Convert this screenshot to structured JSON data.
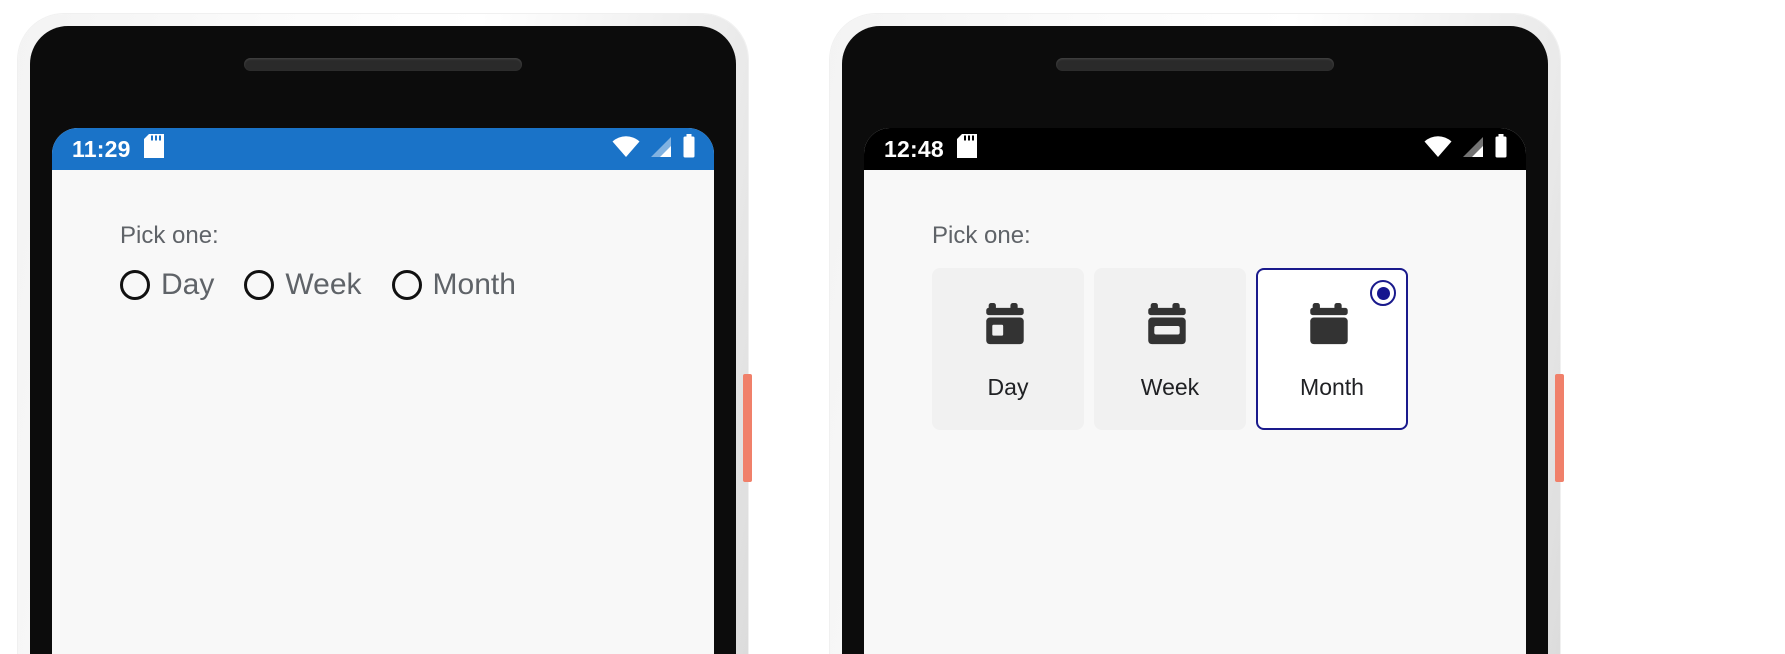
{
  "background_color": "#ffffff",
  "phones": [
    {
      "id": "left",
      "variant": "plain-radio-buttons",
      "status_bar": {
        "background_color": "#1a73c8",
        "time": "11:29",
        "left_icons": [
          "sd-card-icon"
        ],
        "right_icons": [
          "wifi-icon",
          "cellular-signal-icon",
          "battery-icon"
        ]
      },
      "screen": {
        "background_color": "#f8f8f8",
        "prompt": "Pick one:",
        "control_type": "radio-group",
        "options": [
          {
            "label": "Day",
            "selected": false
          },
          {
            "label": "Week",
            "selected": false
          },
          {
            "label": "Month",
            "selected": false
          }
        ]
      },
      "hardware": {
        "power_button_color": "#f0806a",
        "bezel_color": "#f1f1f1",
        "screen_color": "#0c0c0c"
      }
    },
    {
      "id": "right",
      "variant": "card-selection-group",
      "status_bar": {
        "background_color": "#000000",
        "time": "12:48",
        "left_icons": [
          "sd-card-icon"
        ],
        "right_icons": [
          "wifi-icon",
          "cellular-signal-icon",
          "battery-icon"
        ]
      },
      "screen": {
        "background_color": "#f8f8f8",
        "prompt": "Pick one:",
        "control_type": "selectable-cards",
        "selected_color": "#1a1a8c",
        "card_background": "#f1f1f1",
        "card_selected_background": "#ffffff",
        "options": [
          {
            "label": "Day",
            "icon": "calendar-day-icon",
            "selected": false
          },
          {
            "label": "Week",
            "icon": "calendar-week-icon",
            "selected": false
          },
          {
            "label": "Month",
            "icon": "calendar-month-icon",
            "selected": true
          }
        ]
      },
      "hardware": {
        "power_button_color": "#f0806a",
        "bezel_color": "#f1f1f1",
        "screen_color": "#0c0c0c"
      }
    }
  ]
}
